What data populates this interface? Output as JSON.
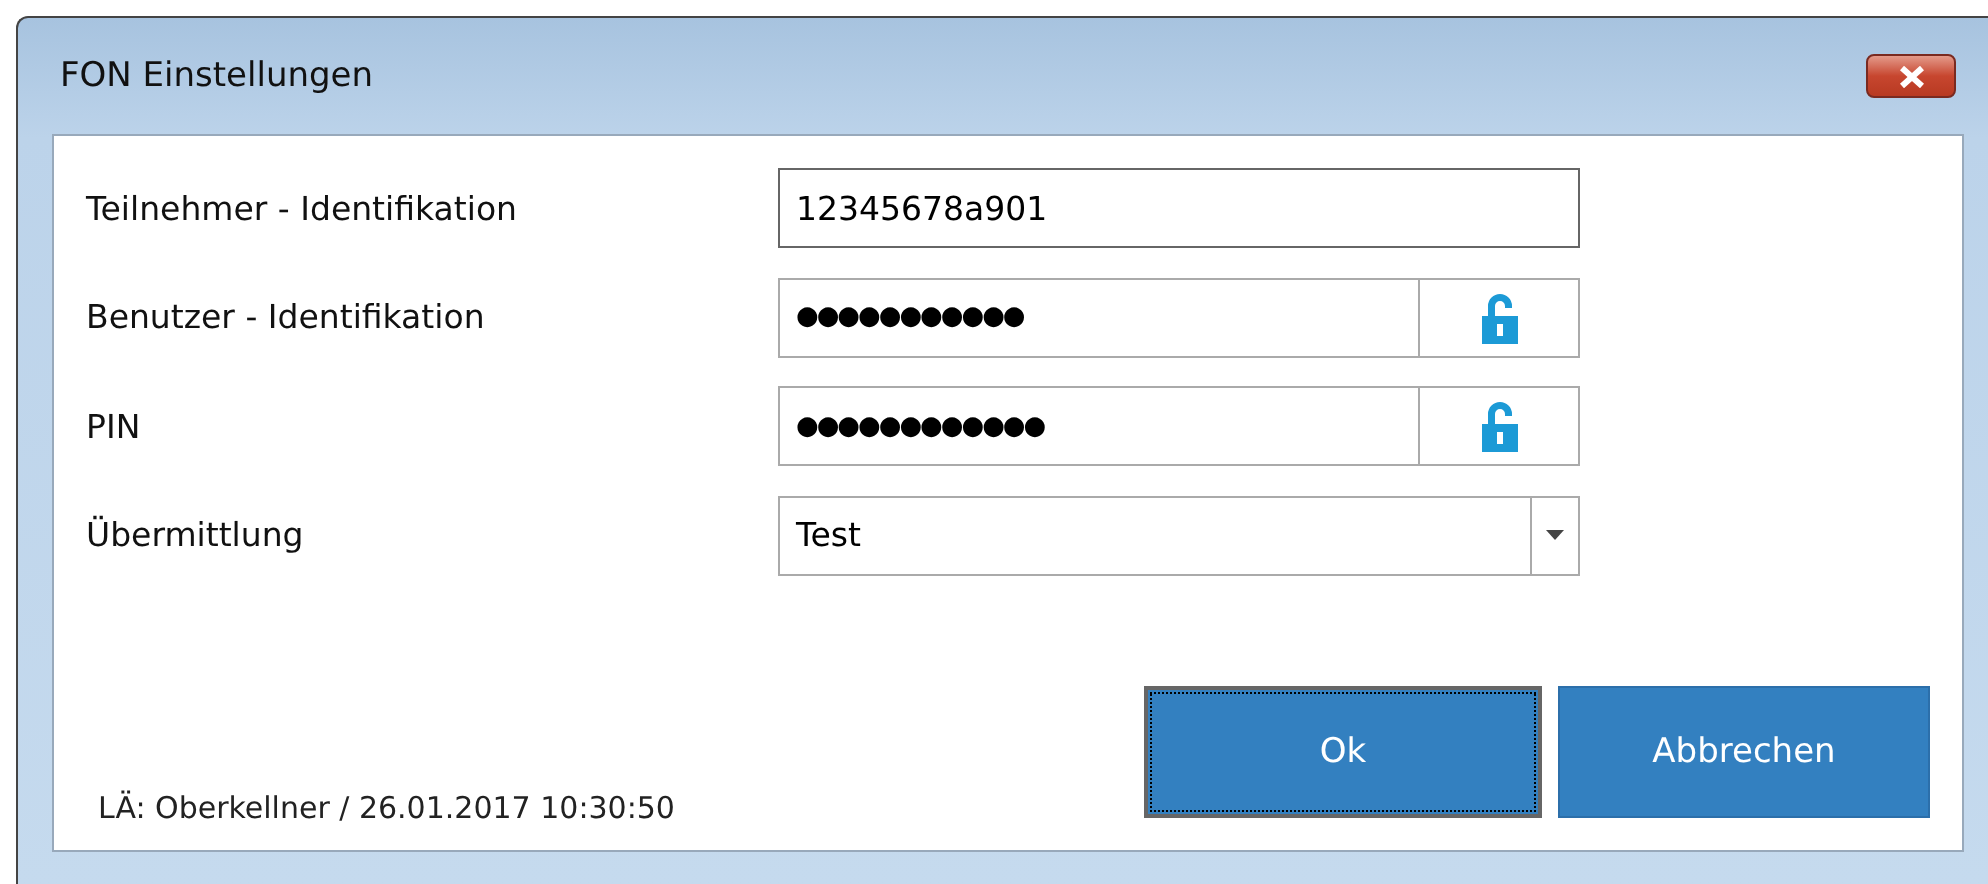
{
  "window": {
    "title": "FON Einstellungen"
  },
  "fields": [
    {
      "label": "Teilnehmer - Identifikation",
      "kind": "text",
      "value": "12345678a901"
    },
    {
      "label": "Benutzer - Identifikation",
      "kind": "password",
      "value": "●●●●●●●●●●●"
    },
    {
      "label": "PIN",
      "kind": "password",
      "value": "●●●●●●●●●●●●"
    },
    {
      "label": "Übermittlung",
      "kind": "select",
      "value": "Test"
    }
  ],
  "buttons": [
    {
      "label": "Ok",
      "focused": true
    },
    {
      "label": "Abbrechen",
      "focused": false
    }
  ],
  "footer": "LÄ: Oberkellner / 26.01.2017 10:30:50"
}
